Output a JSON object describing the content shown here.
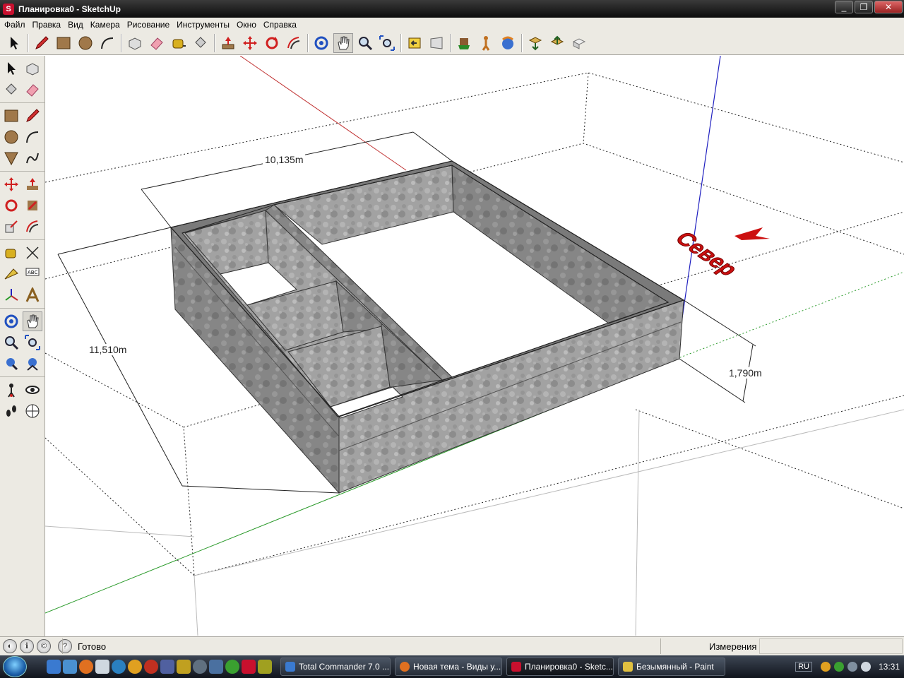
{
  "window": {
    "title": "Планировка0 - SketchUp",
    "app_icon": "sketchup-logo-icon",
    "controls": [
      "_",
      "❐",
      "✕"
    ]
  },
  "menu": [
    "Файл",
    "Правка",
    "Вид",
    "Камера",
    "Рисование",
    "Инструменты",
    "Окно",
    "Справка"
  ],
  "toolbar": {
    "tools": [
      "select-icon",
      "pencil-icon",
      "rectangle-icon",
      "circle-icon",
      "arc-icon",
      "make-component-icon",
      "eraser-icon",
      "tape-measure-icon",
      "paint-bucket-icon",
      "push-pull-icon",
      "move-icon",
      "rotate-icon",
      "offset-icon",
      "orbit-icon",
      "pan-icon",
      "zoom-icon",
      "zoom-extents-icon",
      "previous-view-icon",
      "next-view-icon",
      "position-camera-icon",
      "walk-icon",
      "look-around-icon",
      "get-models-icon",
      "share-model-icon",
      "share-component-icon"
    ]
  },
  "left_toolbar": {
    "tools": [
      "select-icon",
      "make-component-icon",
      "paint-bucket-icon",
      "eraser-icon",
      "rectangle-icon",
      "line-icon",
      "circle-icon",
      "arc-icon",
      "polygon-icon",
      "freehand-icon",
      "move-icon",
      "push-pull-icon",
      "rotate-icon",
      "follow-me-icon",
      "scale-icon",
      "offset-icon",
      "tape-measure-icon",
      "dimension-icon",
      "protractor-icon",
      "text-icon",
      "axes-icon",
      "3d-text-icon",
      "orbit-icon",
      "pan-icon",
      "zoom-icon",
      "zoom-window-icon",
      "zoom-extents-icon",
      "previous-icon",
      "position-camera-icon",
      "look-around-icon",
      "walk-icon",
      "section-plane-icon"
    ]
  },
  "model": {
    "dim_length": "10,135m",
    "dim_width": "11,510m",
    "dim_height": "1,790m",
    "north_label": "Север",
    "colors": {
      "red_axis": "#c03030",
      "green_axis": "#2a9a2a",
      "blue_axis": "#2020c0",
      "wall": "#9a9a9a",
      "north": "#cc1010"
    }
  },
  "status": {
    "text": "Готово",
    "measure_label": "Измерения",
    "measure_value": ""
  },
  "taskbar": {
    "tasks": [
      {
        "label": "Total Commander 7.0 ...",
        "icon_color": "#3a7ad0"
      },
      {
        "label": "Новая тема - Виды у...",
        "icon_color": "#e07020"
      },
      {
        "label": "Планировка0 - Sketc...",
        "icon_color": "#c8102e",
        "active": true
      },
      {
        "label": "Безымянный - Paint",
        "icon_color": "#e0c040"
      }
    ],
    "lang": "RU",
    "clock": "13:31"
  }
}
